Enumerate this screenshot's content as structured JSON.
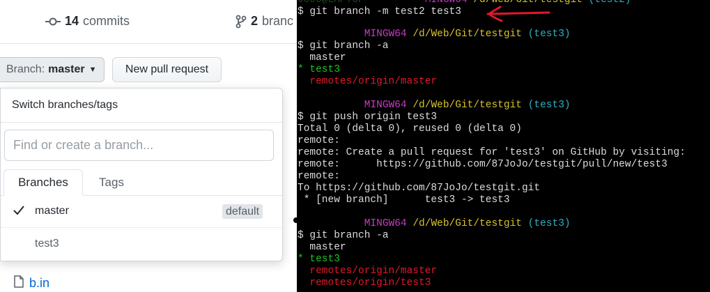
{
  "repo": {
    "commits_count": "14",
    "commits_label": "commits",
    "branches_count": "2",
    "branches_label": "branc"
  },
  "branch_button": {
    "label": "Branch:",
    "value": "master"
  },
  "new_pr_button": "New pull request",
  "switcher": {
    "title": "Switch branches/tags",
    "placeholder": "Find or create a branch...",
    "tabs": [
      "Branches",
      "Tags"
    ],
    "branches": [
      {
        "name": "master",
        "badge": "default"
      },
      {
        "name": "test3"
      }
    ]
  },
  "file_link": "b.in",
  "terminal": {
    "prompt_host": "MINGW64",
    "prompt_path": "/d/Web/Git/testgit",
    "lines": [
      {
        "cmd": "$ git branch -m test2 test3"
      },
      {
        "prompt_branch": "(test3)"
      },
      {
        "cmd": "$ git branch -a"
      },
      {
        "out": "  master"
      },
      {
        "current": "* test3"
      },
      {
        "remote": "  remotes/origin/master"
      },
      {
        "prompt_branch": "(test3)"
      },
      {
        "cmd": "$ git push origin test3"
      },
      {
        "out": "Total 0 (delta 0), reused 0 (delta 0)"
      },
      {
        "out": "remote:"
      },
      {
        "out": "remote: Create a pull request for 'test3' on GitHub by visiting:"
      },
      {
        "out": "remote:      https://github.com/87JoJo/testgit/pull/new/test3"
      },
      {
        "out": "remote:"
      },
      {
        "out": "To https://github.com/87JoJo/testgit.git"
      },
      {
        "out": " * [new branch]      test3 -> test3"
      },
      {
        "prompt_branch": "(test3)"
      },
      {
        "cmd": "$ git branch -a"
      },
      {
        "out": "  master"
      },
      {
        "current": "* test3"
      },
      {
        "remote": "  remotes/origin/master"
      },
      {
        "remote": "  remotes/origin/test3"
      }
    ]
  },
  "colors": {
    "prompt_host": "#c839c5",
    "prompt_path": "#d7c32c",
    "prompt_branch": "#2fb0c0",
    "current_branch": "#1dc121",
    "remote_branch": "#e0192a",
    "annotation_arrow": "#e0192a",
    "link": "#0366d6"
  },
  "icons": [
    "commit-icon",
    "branch-icon",
    "caret-down-icon",
    "check-icon",
    "file-icon",
    "annotation-arrow-icon"
  ]
}
